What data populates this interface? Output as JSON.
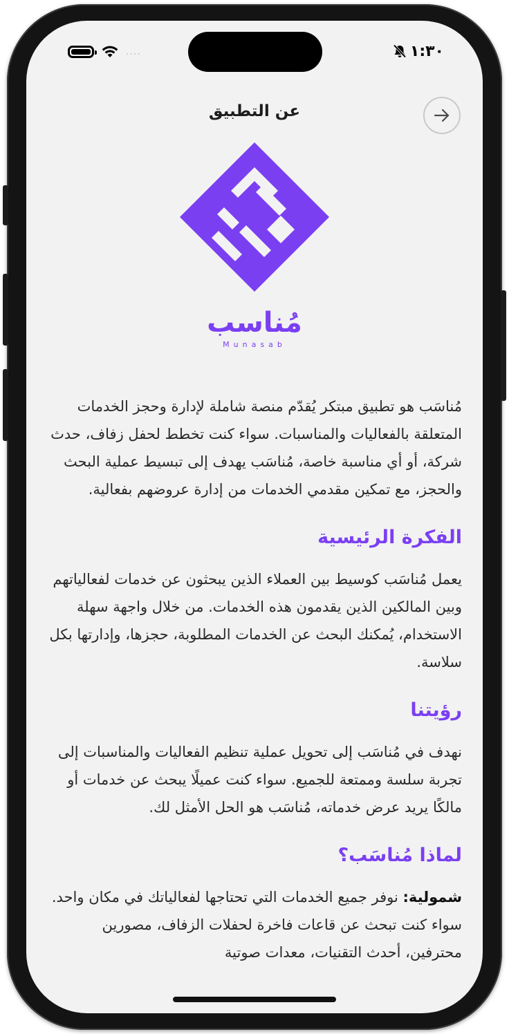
{
  "status_bar": {
    "time": "١:٣٠",
    "signal_dots": "....",
    "icons": [
      "battery-icon",
      "wifi-icon",
      "bell-slash-icon"
    ]
  },
  "header": {
    "title": "عن التطبيق",
    "back_icon": "arrow-right-icon"
  },
  "brand": {
    "name_ar": "مُناسب",
    "name_en": "Munasab",
    "color": "#7b3ff2"
  },
  "about": {
    "intro": "مُناسَب هو تطبيق مبتكر يُقدّم منصة شاملة لإدارة وحجز الخدمات المتعلقة بالفعاليات والمناسبات. سواء كنت تخطط لحفل زفاف، حدث شركة، أو أي مناسبة خاصة، مُناسَب يهدف إلى تبسيط عملية البحث والحجز، مع تمكين مقدمي الخدمات من إدارة عروضهم بفعالية.",
    "idea_title": "الفكرة الرئيسية",
    "idea_text": "يعمل مُناسَب كوسيط بين العملاء الذين يبحثون عن خدمات لفعالياتهم وبين المالكين الذين يقدمون هذه الخدمات. من خلال واجهة سهلة الاستخدام، يُمكنك البحث عن الخدمات المطلوبة، حجزها، وإدارتها بكل سلاسة.",
    "vision_title": "رؤيتنا",
    "vision_text": "نهدف في مُناسَب إلى تحويل عملية تنظيم الفعاليات والمناسبات إلى تجربة سلسة وممتعة للجميع. سواء كنت عميلًا يبحث عن خدمات أو مالكًا يريد عرض خدماته، مُناسَب هو الحل الأمثل لك.",
    "why_title": "لماذا مُناسَب؟",
    "why_label": "شمولية:",
    "why_text": " نوفر جميع الخدمات التي تحتاجها لفعالياتك في مكان واحد. سواء كنت تبحث عن قاعات فاخرة لحفلات الزفاف، مصورين محترفين، أحدث التقنيات، معدات صوتية"
  }
}
